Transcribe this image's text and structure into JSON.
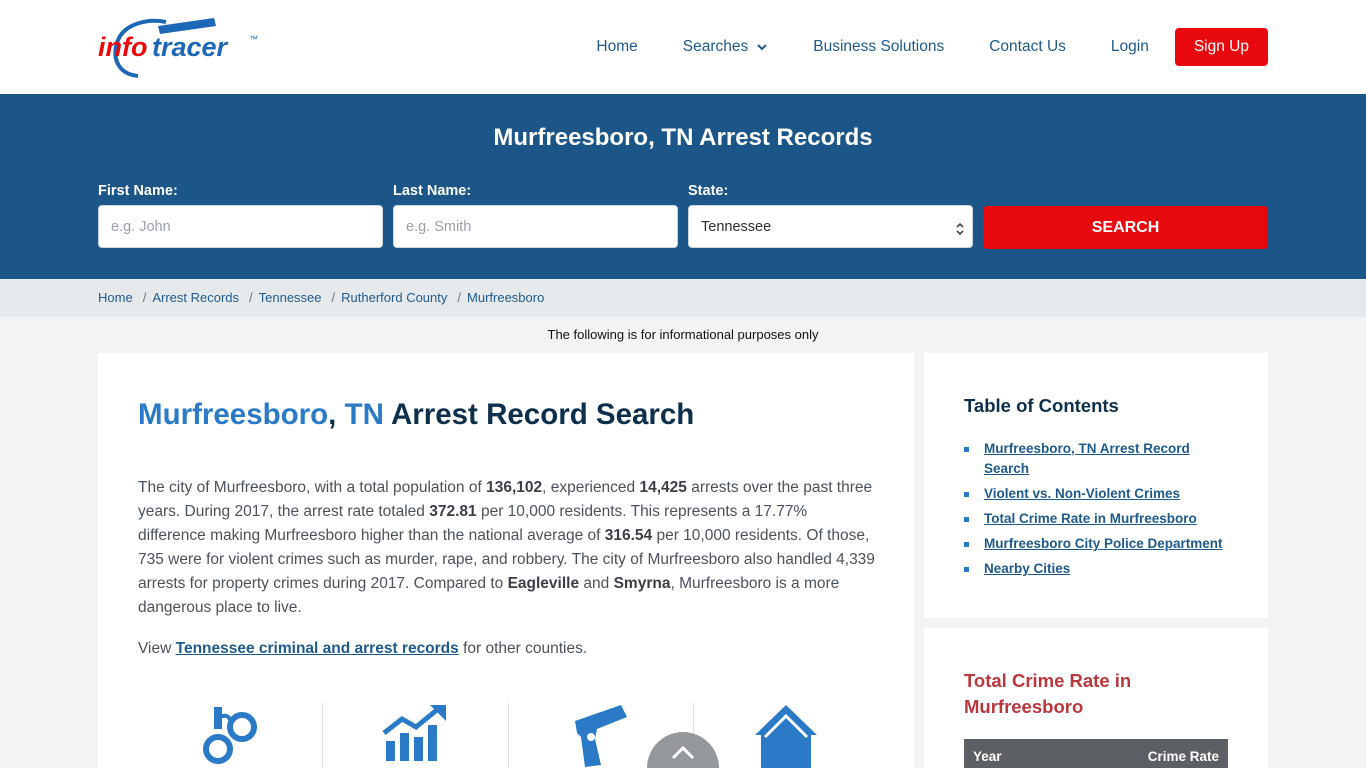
{
  "header": {
    "logo_text_info": "info",
    "logo_text_tracer": "tracer",
    "logo_tm": "™",
    "nav": {
      "home": "Home",
      "searches": "Searches",
      "business": "Business Solutions",
      "contact": "Contact Us",
      "login": "Login",
      "signup": "Sign Up"
    }
  },
  "hero": {
    "title": "Murfreesboro, TN Arrest Records",
    "first_name_label": "First Name:",
    "first_name_placeholder": "e.g. John",
    "last_name_label": "Last Name:",
    "last_name_placeholder": "e.g. Smith",
    "state_label": "State:",
    "state_value": "Tennessee",
    "search_button": "SEARCH"
  },
  "breadcrumb": [
    "Home",
    "Arrest Records",
    "Tennessee",
    "Rutherford County",
    "Murfreesboro"
  ],
  "breadcrumb_sep": "/",
  "disclaimer": "The following is for informational purposes only",
  "main": {
    "title_city": "Murfreesboro",
    "title_comma": ",",
    "title_state": "TN",
    "title_rest": "Arrest Record Search",
    "intro": {
      "p1": "The city of Murfreesboro, with a total population of ",
      "population": "136,102",
      "p2": ", experienced ",
      "arrests": "14,425",
      "p3": " arrests over the past three years. During 2017, the arrest rate totaled ",
      "rate": "372.81",
      "p4": " per 10,000 residents. This represents a 17.77% difference making Murfreesboro higher than the national average of ",
      "national": "316.54",
      "p5": " per 10,000 residents. Of those, 735 were for violent crimes such as murder, rape, and robbery. The city of Murfreesboro also handled 4,339 arrests for property crimes during 2017. Compared to ",
      "city1": "Eagleville",
      "p6": " and ",
      "city2": "Smyrna",
      "p7": ", Murfreesboro is a more dangerous place to live."
    },
    "view_prefix": "View ",
    "view_link": "Tennessee criminal and arrest records",
    "view_suffix": " for other counties.",
    "icons": [
      "handcuffs-icon",
      "chart-up-icon",
      "gun-icon",
      "house-icon"
    ]
  },
  "toc": {
    "title": "Table of Contents",
    "items": [
      "Murfreesboro, TN Arrest Record Search",
      "Violent vs. Non-Violent Crimes",
      "Total Crime Rate in Murfreesboro",
      "Murfreesboro City Police Department",
      "Nearby Cities"
    ]
  },
  "rate_card": {
    "title": "Total Crime Rate in Murfreesboro",
    "col_year": "Year",
    "col_rate": "Crime Rate"
  },
  "colors": {
    "brand_blue": "#1c5689",
    "accent_red": "#e8090f",
    "link_blue": "#1f5a8c"
  }
}
